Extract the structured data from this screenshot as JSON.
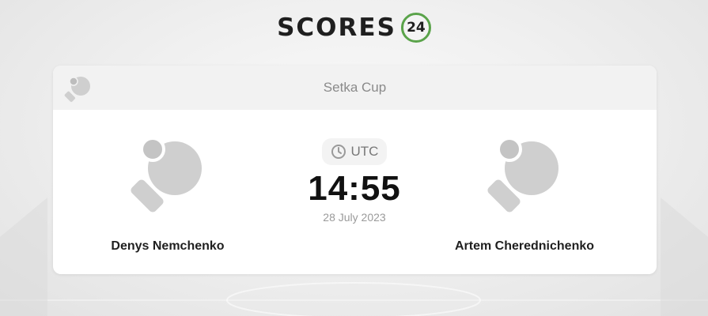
{
  "brand": {
    "name": "SCORES",
    "badge": "24",
    "badge_color": "#5aa34a"
  },
  "match": {
    "league": "Setka Cup",
    "sport_icon": "table-tennis-icon",
    "home_team": {
      "name": "Denys Nemchenko",
      "logo_icon": "table-tennis-paddle-icon"
    },
    "away_team": {
      "name": "Artem Cherednichenko",
      "logo_icon": "table-tennis-paddle-icon"
    },
    "timezone_label": "UTC",
    "time": "14:55",
    "date": "28 July 2023"
  },
  "colors": {
    "icon_gray": "#cfcfcf",
    "text_dark": "#1f1f1f",
    "text_muted": "#9a9a9a"
  }
}
